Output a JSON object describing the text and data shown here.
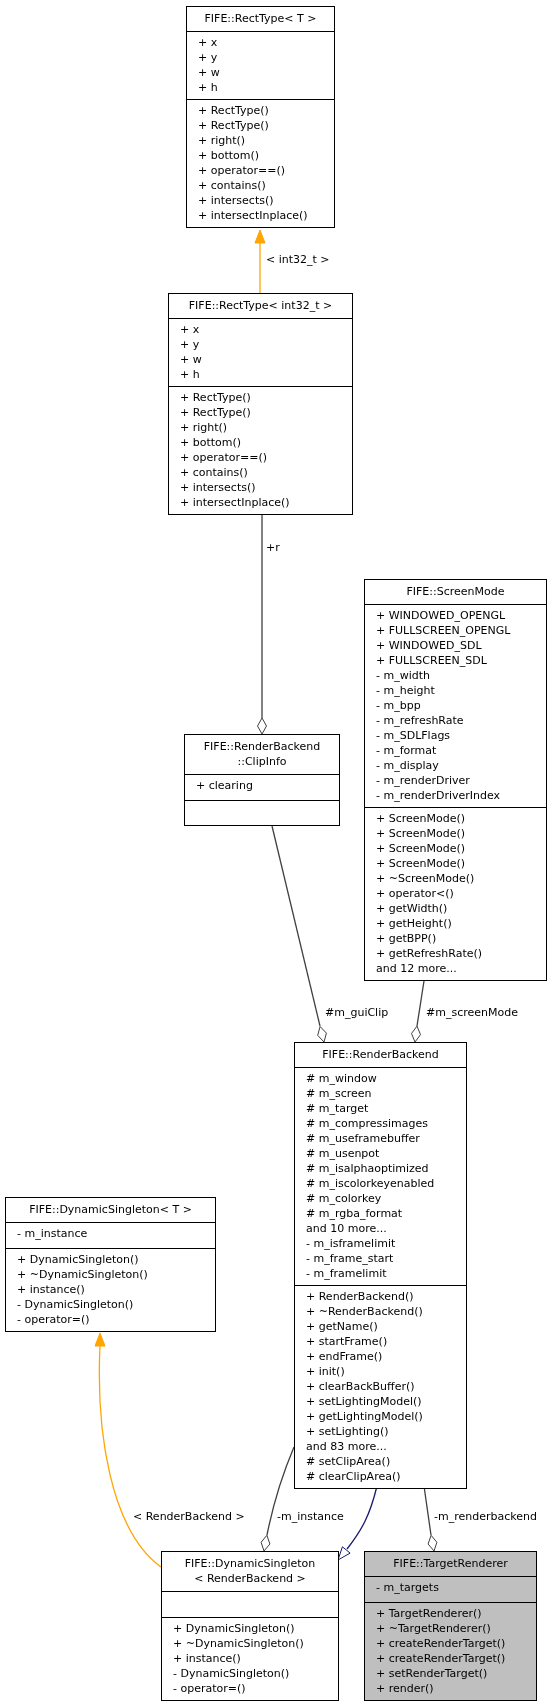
{
  "classes": [
    {
      "title": [
        "FIFE::RectType< T >"
      ],
      "attributes": [
        "+ x",
        "+ y",
        "+ w",
        "+ h"
      ],
      "methods": [
        "+ RectType()",
        "+ RectType()",
        "+ right()",
        "+ bottom()",
        "+ operator==()",
        "+ contains()",
        "+ intersects()",
        "+ intersectInplace()"
      ],
      "highlighted": false
    },
    {
      "title": [
        "FIFE::RectType< int32_t >"
      ],
      "attributes": [
        "+ x",
        "+ y",
        "+ w",
        "+ h"
      ],
      "methods": [
        "+ RectType()",
        "+ RectType()",
        "+ right()",
        "+ bottom()",
        "+ operator==()",
        "+ contains()",
        "+ intersects()",
        "+ intersectInplace()"
      ],
      "highlighted": false
    },
    {
      "title": [
        "FIFE::ScreenMode"
      ],
      "attributes": [
        "+ WINDOWED_OPENGL",
        "+ FULLSCREEN_OPENGL",
        "+ WINDOWED_SDL",
        "+ FULLSCREEN_SDL",
        "- m_width",
        "- m_height",
        "- m_bpp",
        "- m_refreshRate",
        "- m_SDLFlags",
        "- m_format",
        "- m_display",
        "- m_renderDriver",
        "- m_renderDriverIndex"
      ],
      "methods": [
        "+ ScreenMode()",
        "+ ScreenMode()",
        "+ ScreenMode()",
        "+ ScreenMode()",
        "+ ~ScreenMode()",
        "+ operator<()",
        "+ getWidth()",
        "+ getHeight()",
        "+ getBPP()",
        "+ getRefreshRate()",
        "and 12 more..."
      ],
      "highlighted": false
    },
    {
      "title": [
        "FIFE::RenderBackend",
        "::ClipInfo"
      ],
      "attributes": [
        "+ clearing"
      ],
      "highlighted": false
    },
    {
      "title": [
        "FIFE::DynamicSingleton< T >"
      ],
      "attributes": [
        "- m_instance"
      ],
      "methods": [
        "+ DynamicSingleton()",
        "+ ~DynamicSingleton()",
        "+ instance()",
        "- DynamicSingleton()",
        "- operator=()"
      ],
      "highlighted": false
    },
    {
      "title": [
        "FIFE::RenderBackend"
      ],
      "attributes": [
        "# m_window",
        "# m_screen",
        "# m_target",
        "# m_compressimages",
        "# m_useframebuffer",
        "# m_usenpot",
        "# m_isalphaoptimized",
        "# m_iscolorkeyenabled",
        "# m_colorkey",
        "# m_rgba_format",
        "and 10 more...",
        "- m_isframelimit",
        "- m_frame_start",
        "- m_framelimit"
      ],
      "methods": [
        "+ RenderBackend()",
        "+ ~RenderBackend()",
        "+ getName()",
        "+ startFrame()",
        "+ endFrame()",
        "+ init()",
        "+ clearBackBuffer()",
        "+ setLightingModel()",
        "+ getLightingModel()",
        "+ setLighting()",
        "and 83 more...",
        "# setClipArea()",
        "# clearClipArea()"
      ],
      "highlighted": false
    },
    {
      "title": [
        "FIFE::DynamicSingleton",
        "< RenderBackend >"
      ],
      "methods": [
        "+ DynamicSingleton()",
        "+ ~DynamicSingleton()",
        "+ instance()",
        "- DynamicSingleton()",
        "- operator=()"
      ],
      "highlighted": false
    },
    {
      "title": [
        "FIFE::TargetRenderer"
      ],
      "attributes": [
        "- m_targets"
      ],
      "methods": [
        "+ TargetRenderer()",
        "+ ~TargetRenderer()",
        "+ createRenderTarget()",
        "+ createRenderTarget()",
        "+ setRenderTarget()",
        "+ render()"
      ],
      "highlighted": true
    }
  ],
  "relations": [
    {
      "kind": "template",
      "label": "< int32_t >"
    },
    {
      "kind": "aggregation",
      "label": "+r"
    },
    {
      "kind": "aggregation",
      "label": "#m_guiClip"
    },
    {
      "kind": "aggregation",
      "label": "#m_screenMode"
    },
    {
      "kind": "template",
      "label": "< RenderBackend >"
    },
    {
      "kind": "aggregation",
      "label": "-m_instance"
    },
    {
      "kind": "inheritance"
    },
    {
      "kind": "aggregation",
      "label": "-m_renderbackend"
    }
  ]
}
